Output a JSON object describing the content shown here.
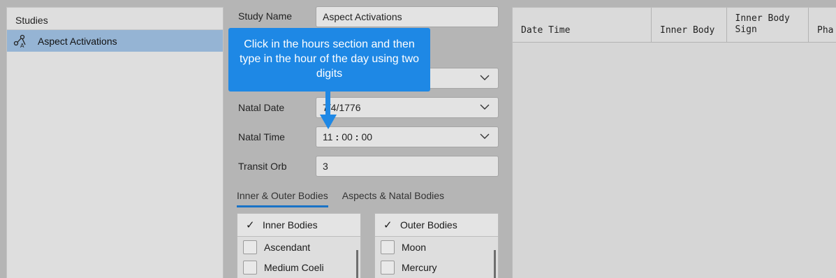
{
  "sidebar": {
    "header": "Studies",
    "items": [
      {
        "label": "Aspect Activations",
        "icon": "graph-nodes-icon",
        "selected": true
      }
    ]
  },
  "form": {
    "study_name_label": "Study Name",
    "study_name_value": "Aspect Activations",
    "natal_date_label": "Natal Date",
    "natal_date_value": "7/4/1776",
    "natal_time_label": "Natal Time",
    "natal_time": {
      "hours": "11",
      "minutes": "00",
      "seconds": "00",
      "separator": ":"
    },
    "transit_orb_label": "Transit Orb",
    "transit_orb_value": "3"
  },
  "tabs": [
    {
      "label": "Inner & Outer Bodies",
      "active": true
    },
    {
      "label": "Aspects & Natal Bodies",
      "active": false
    }
  ],
  "inner_bodies": {
    "header": "Inner Bodies",
    "header_check": "✓",
    "items": [
      "Ascendant",
      "Medium Coeli"
    ]
  },
  "outer_bodies": {
    "header": "Outer Bodies",
    "header_check": "✓",
    "items": [
      "Moon",
      "Mercury"
    ]
  },
  "grid": {
    "columns": [
      "Date Time",
      "Inner Body",
      "Inner Body\nSign",
      "Pha"
    ]
  },
  "callout": {
    "text": "Click in the hours section and then type in the hour of the day using two digits"
  },
  "colors": {
    "accent": "#1e88e5",
    "selection": "#95b4d4",
    "tab_underline": "#1a73c6"
  }
}
